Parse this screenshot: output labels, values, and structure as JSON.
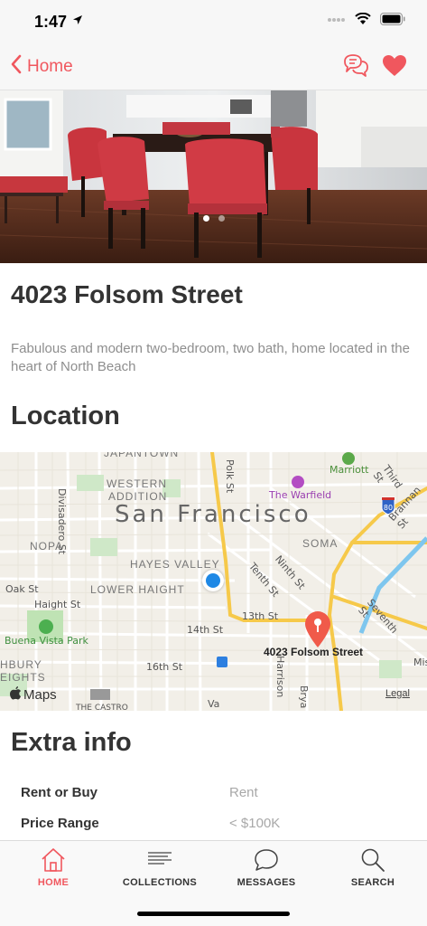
{
  "status_bar": {
    "time": "1:47"
  },
  "nav": {
    "back_label": "Home"
  },
  "hero": {
    "page_count": 2,
    "active_page": 1
  },
  "listing": {
    "title": "4023 Folsom Street",
    "description": "Fabulous and modern two-bedroom, two bath, home located in the heart of North Beach"
  },
  "location": {
    "heading": "Location",
    "map": {
      "city": "San Francisco",
      "pin_label": "4023 Folsom Street",
      "attribution": "Maps",
      "legal": "Legal",
      "districts": [
        "JAPANTOWN",
        "WESTERN",
        "ADDITION",
        "NOPA",
        "HAYES VALLEY",
        "LOWER HAIGHT",
        "SOMA",
        "HBURY",
        "EIGHTS",
        "THE CASTRO"
      ],
      "streets": [
        "Divisadero St",
        "Polk St",
        "Oak St",
        "Haight St",
        "Tenth St",
        "Ninth St",
        "13th St",
        "14th St",
        "16th St",
        "Harrison",
        "Brya",
        "Brannan St",
        "Seventh St",
        "Third St",
        "Va",
        "Mis"
      ],
      "places": [
        "Marriott",
        "The Warfield",
        "Buena Vista Park"
      ],
      "highway": "80"
    }
  },
  "extra": {
    "heading": "Extra info",
    "rows": [
      {
        "key": "Rent or Buy",
        "value": "Rent"
      },
      {
        "key": "Price Range",
        "value": "< $100K"
      }
    ]
  },
  "tabs": [
    {
      "label": "HOME",
      "active": true
    },
    {
      "label": "COLLECTIONS",
      "active": false
    },
    {
      "label": "MESSAGES",
      "active": false
    },
    {
      "label": "SEARCH",
      "active": false
    }
  ],
  "colors": {
    "accent": "#f0575e",
    "map_pin": "#f05a4a",
    "user_dot": "#1e88e5",
    "highway": "#f6c94a"
  }
}
